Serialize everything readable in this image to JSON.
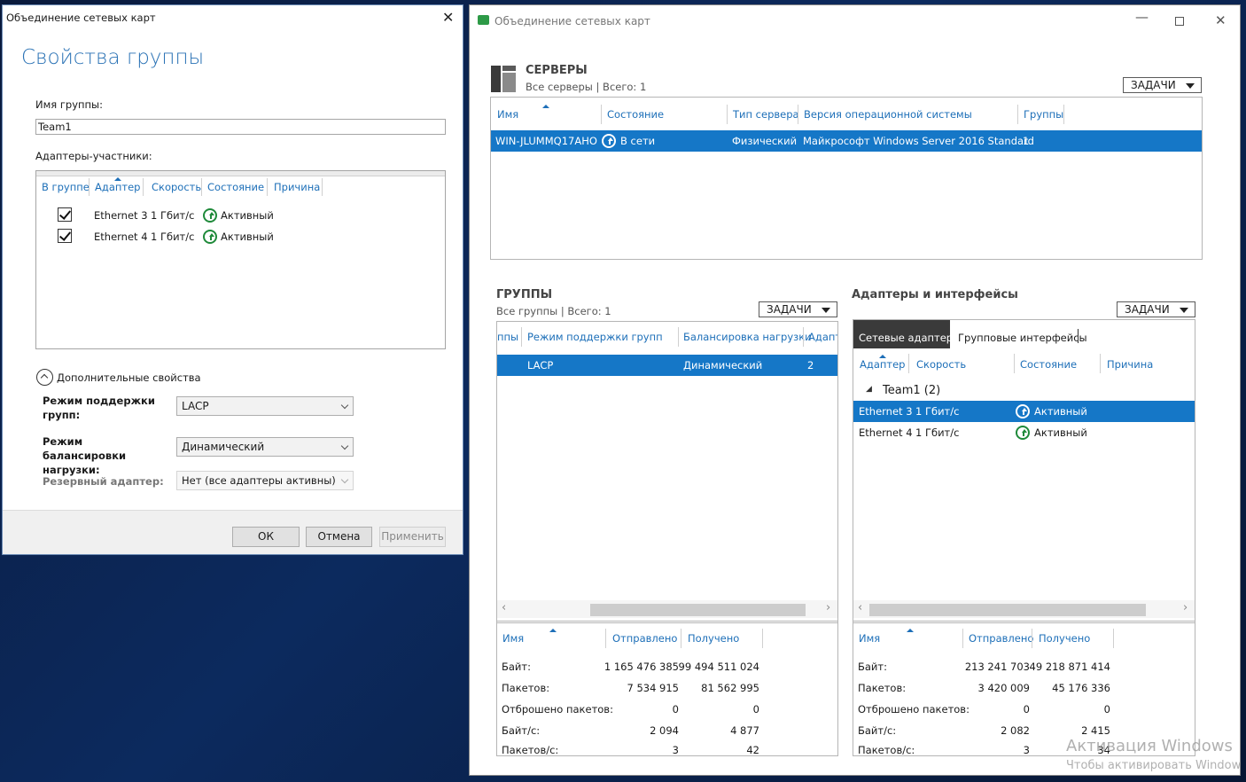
{
  "left_dialog": {
    "window_title": "Объединение сетевых карт",
    "heading": "Свойства группы",
    "group_name_label": "Имя группы:",
    "group_name_value": "Team1",
    "members_label": "Адаптеры-участники:",
    "columns": [
      "В группе",
      "Адаптер",
      "Скорость",
      "Состояние",
      "Причина"
    ],
    "members": [
      {
        "checked": true,
        "adapter": "Ethernet 3",
        "speed": "1 Гбит/с",
        "state": "Активный"
      },
      {
        "checked": true,
        "adapter": "Ethernet 4",
        "speed": "1 Гбит/с",
        "state": "Активный"
      }
    ],
    "advanced_label": "Дополнительные свойства",
    "teaming_mode_label": "Режим поддержки групп:",
    "teaming_mode_value": "LACP",
    "lb_mode_label": "Режим балансировки нагрузки:",
    "lb_mode_value": "Динамический",
    "standby_label": "Резервный адаптер:",
    "standby_value": "Нет (все адаптеры активны)",
    "ok_label": "ОК",
    "cancel_label": "Отмена",
    "apply_label": "Применить"
  },
  "main_window": {
    "title": "Объединение сетевых карт",
    "servers": {
      "title": "СЕРВЕРЫ",
      "subtitle": "Все серверы | Всего: 1",
      "tasks_label": "ЗАДАЧИ",
      "columns": [
        "Имя",
        "Состояние",
        "Тип сервера",
        "Версия операционной системы",
        "Группы"
      ],
      "row": {
        "name": "WIN-JLUMMQ17AHO",
        "state": "В сети",
        "type": "Физический",
        "os": "Майкрософт Windows Server 2016 Standard",
        "groups": "1"
      }
    },
    "groups": {
      "title": "ГРУППЫ",
      "subtitle": "Все группы | Всего: 1",
      "tasks_label": "ЗАДАЧИ",
      "columns": [
        "ппы",
        "Режим поддержки групп",
        "Балансировка нагрузки",
        "Адапт"
      ],
      "row": {
        "mode": "LACP",
        "balancing": "Динамический",
        "adapters": "2"
      }
    },
    "adapters": {
      "title": "Адаптеры и интерфейсы",
      "tasks_label": "ЗАДАЧИ",
      "tab_active": "Сетевые адаптеры",
      "tab_other": "Групповые интерфейсы",
      "columns": [
        "Адаптер",
        "Скорость",
        "Состояние",
        "Причина"
      ],
      "group_label": "Team1 (2)",
      "rows": [
        {
          "adapter": "Ethernet 3",
          "speed": "1 Гбит/с",
          "state": "Активный"
        },
        {
          "adapter": "Ethernet 4",
          "speed": "1 Гбит/с",
          "state": "Активный"
        }
      ]
    },
    "stats_columns": [
      "Имя",
      "Отправлено",
      "Получено"
    ],
    "stats_labels": [
      "Байт:",
      "Пакетов:",
      "Отброшено пакетов:",
      "Байт/с:",
      "Пакетов/с:"
    ],
    "group_stats": {
      "sent": [
        "1 165 476 385",
        "7 534 915",
        "0",
        "2 094",
        "3"
      ],
      "received": [
        "99 494 511 024",
        "81 562 995",
        "0",
        "4 877",
        "42"
      ]
    },
    "adapter_stats": {
      "sent": [
        "213 241 703",
        "3 420 009",
        "0",
        "2 082",
        "3"
      ],
      "received": [
        "49 218 871 414",
        "45 176 336",
        "0",
        "2 415",
        "34"
      ]
    }
  },
  "watermark": {
    "line1": "Активация Windows",
    "line2": "Чтобы активировать Window"
  }
}
